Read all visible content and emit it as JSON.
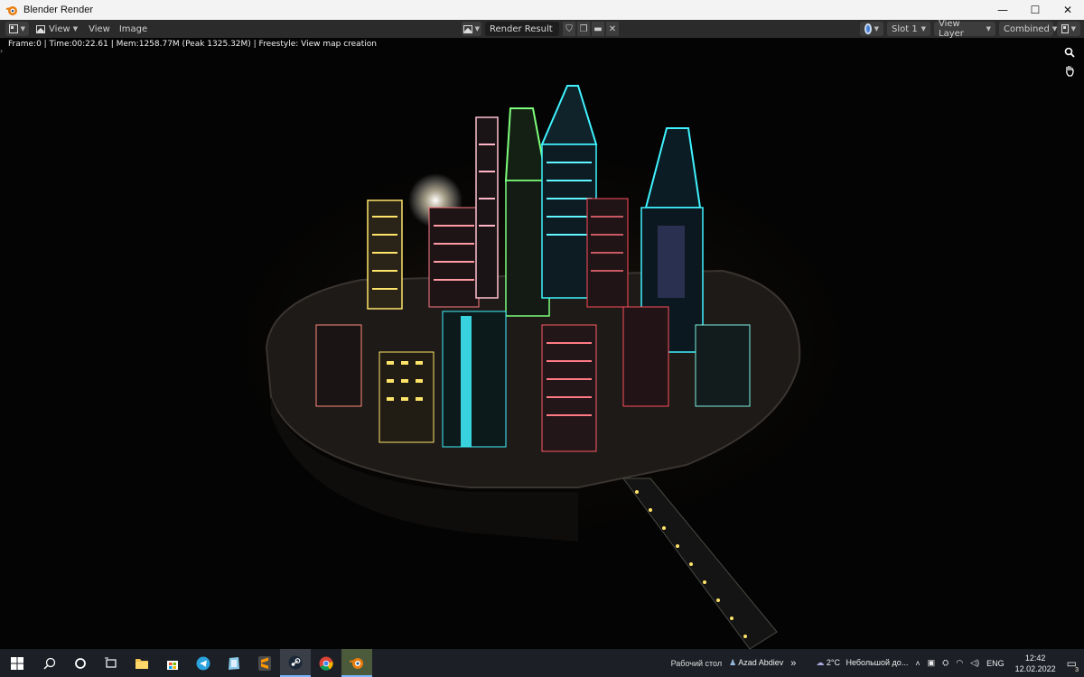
{
  "window": {
    "title": "Blender Render",
    "controls": {
      "minimize": "—",
      "maximize": "☐",
      "close": "✕"
    }
  },
  "header": {
    "menu": {
      "view1": "View",
      "view2": "View",
      "image": "Image"
    },
    "render_slot_name": "Render Result",
    "slot": "Slot 1",
    "view_layer": "View Layer",
    "pass": "Combined"
  },
  "viewport": {
    "stats": "Frame:0 | Time:00:22.61 | Mem:1258.77M (Peak 1325.32M) | Freestyle: View map creation",
    "edge_arrow": "›",
    "zoom_icon": "🔍",
    "pan_icon": "✋"
  },
  "taskbar": {
    "desktop_label": "Рабочий стол",
    "user": "Azad Abdiev",
    "overflow": "»",
    "weather_temp": "2°C",
    "weather_text": "Небольшой до...",
    "lang": "ENG",
    "time": "12:42",
    "date": "12.02.2022",
    "notification_count": "3"
  },
  "colors": {
    "neon_cyan": "#3ff3ff",
    "neon_red": "#ff4d5a",
    "neon_yellow": "#ffe46a",
    "neon_green": "#7dff7a",
    "taskbar_bg": "#1c1f26"
  }
}
